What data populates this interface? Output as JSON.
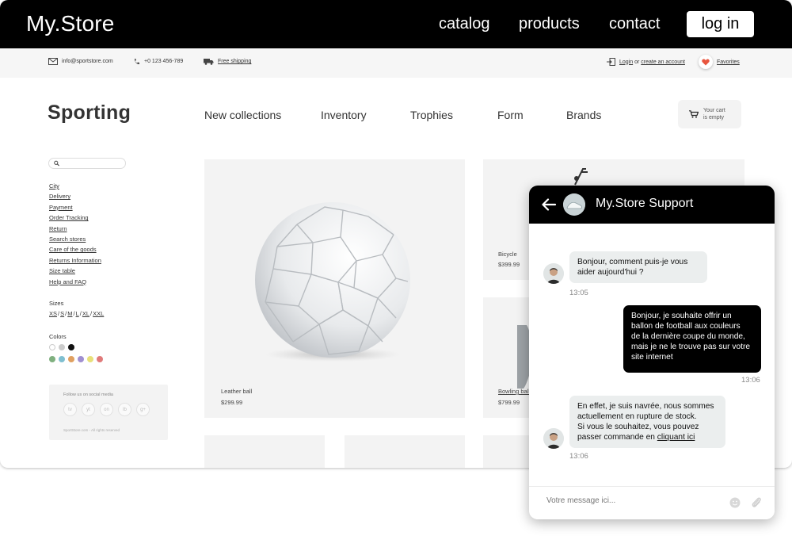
{
  "header": {
    "brand": "My.Store",
    "nav": [
      "catalog",
      "products",
      "contact"
    ],
    "login": "log in"
  },
  "infobar": {
    "email": "info@sportstore.com",
    "phone": "+0 123 456-789",
    "shipping": "Free shipping",
    "login_text": "Login",
    "or_text": "or",
    "create_account": "create an account",
    "favorites": "Favorites"
  },
  "store": {
    "title": "Sporting",
    "categories": [
      "New collections",
      "Inventory",
      "Trophies",
      "Form",
      "Brands"
    ],
    "cart_line1": "Your cart",
    "cart_line2": "is empty"
  },
  "sidebar": {
    "links": [
      "City",
      "Delivery",
      "Payment",
      "Order Tracking",
      "Return",
      "Search stores",
      "Care of the goods",
      "Returns Information",
      "Size table",
      "Help and FAQ"
    ],
    "sizes_label": "Sizes",
    "sizes": [
      "XS",
      "S",
      "M",
      "L",
      "XL",
      "XXL"
    ],
    "colors_label": "Colors",
    "social_title": "Follow us on social media",
    "social_icons": [
      "tv",
      "yt",
      "on",
      "lb",
      "g+"
    ],
    "copyright": "SportStore.com - All rights reserved"
  },
  "colors": {
    "swatches_row1": [
      "#ffffff",
      "#cccccc",
      "#111111"
    ],
    "swatches_row2": [
      "#7fb07f",
      "#7fbfd0",
      "#e0a060",
      "#a08fd0",
      "#e8e07a",
      "#e07a7a"
    ],
    "heart": "#e8553e",
    "chat_header": "#000000",
    "bubble_in": "#ebeeee",
    "bubble_out": "#000000"
  },
  "products": [
    {
      "name": "Leather ball",
      "price": "$299.99"
    },
    {
      "name": "Bicycle",
      "price": "$399.99"
    },
    {
      "name": "Bowling ball",
      "price": "$799.99"
    }
  ],
  "chat": {
    "title": "My.Store Support",
    "messages": [
      {
        "from": "agent",
        "lines": [
          "Bonjour, comment puis-je vous",
          "aider aujourd'hui ?"
        ],
        "time": "13:05"
      },
      {
        "from": "user",
        "lines": [
          "Bonjour, je souhaite offrir un",
          "ballon de football aux couleurs",
          "de la dernière coupe du monde,",
          "mais je ne le trouve pas sur votre",
          "site internet"
        ],
        "time": "13:06"
      },
      {
        "from": "agent",
        "lines": [
          "En effet, je suis navrée, nous sommes",
          "actuellement en rupture de stock.",
          "Si vous le souhaitez, vous pouvez"
        ],
        "link_prefix": "passer commande en ",
        "link_text": "cliquant ici",
        "time": "13:06"
      }
    ],
    "input_placeholder": "Votre message ici..."
  }
}
